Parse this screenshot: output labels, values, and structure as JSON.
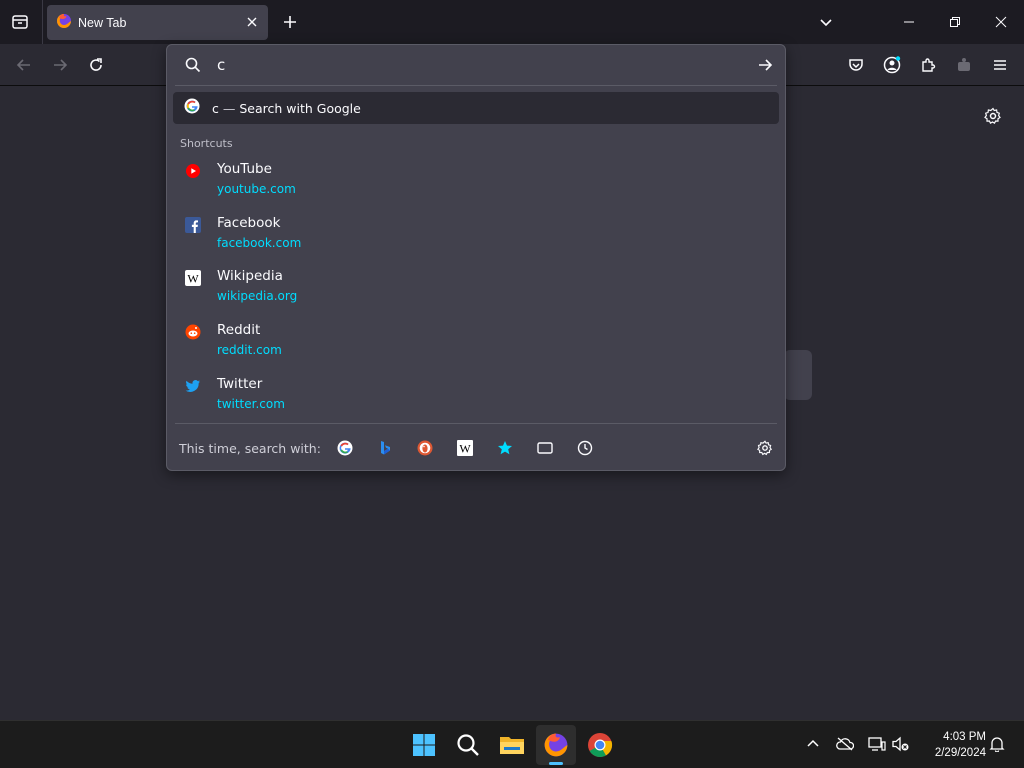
{
  "tab": {
    "title": "New Tab"
  },
  "urlbar": {
    "value": "c",
    "suggestion": {
      "query": "c",
      "separator": "—",
      "action": "Search with Google"
    },
    "shortcuts_label": "Shortcuts",
    "shortcuts": [
      {
        "title": "YouTube",
        "url": "youtube.com",
        "icon": "youtube-icon"
      },
      {
        "title": "Facebook",
        "url": "facebook.com",
        "icon": "facebook-icon"
      },
      {
        "title": "Wikipedia",
        "url": "wikipedia.org",
        "icon": "wikipedia-icon"
      },
      {
        "title": "Reddit",
        "url": "reddit.com",
        "icon": "reddit-icon"
      },
      {
        "title": "Twitter",
        "url": "twitter.com",
        "icon": "twitter-icon"
      }
    ],
    "search_with_label": "This time, search with:",
    "engines": [
      "google-icon",
      "bing-icon",
      "duckduckgo-icon",
      "wikipedia-icon",
      "bookmarks-star-icon",
      "tabs-icon",
      "history-clock-icon"
    ]
  },
  "clock": {
    "time": "4:03 PM",
    "date": "2/29/2024"
  },
  "colors": {
    "accent": "#00ddff",
    "panel": "#42414d",
    "background": "#2b2a33",
    "chrome": "#1c1b22"
  }
}
